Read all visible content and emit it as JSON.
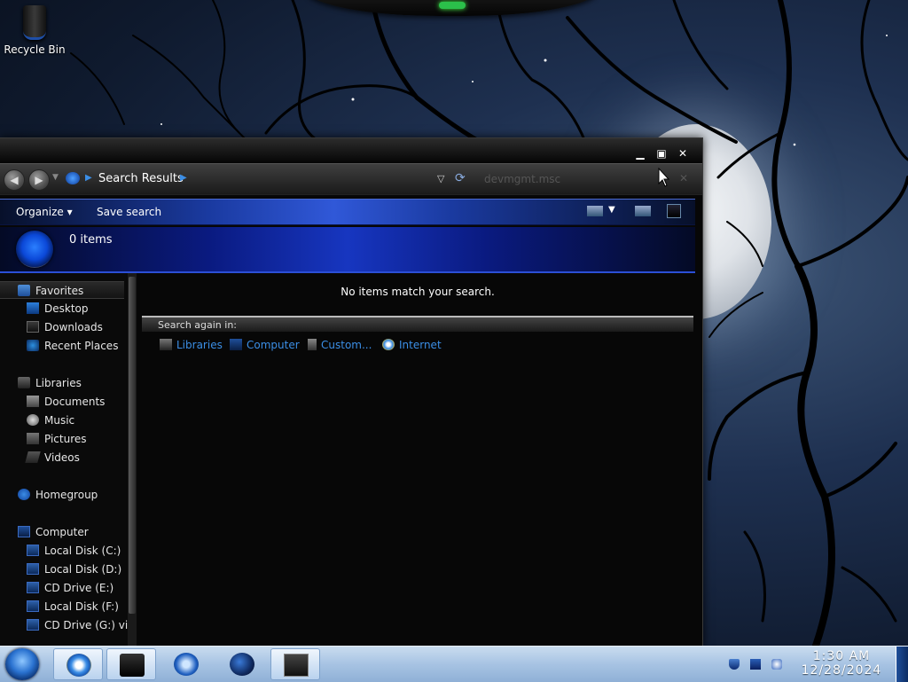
{
  "desktop": {
    "icons": [
      {
        "label": "Recycle Bin",
        "icon": "recycle-bin-icon"
      }
    ]
  },
  "explorer": {
    "address": {
      "breadcrumb": "Search Results",
      "search_text": "devmgmt.msc"
    },
    "toolbar": {
      "organize_label": "Organize",
      "save_search_label": "Save search"
    },
    "details": {
      "item_count": "0 items"
    },
    "nav_pane": {
      "favorites": {
        "label": "Favorites",
        "items": [
          "Desktop",
          "Downloads",
          "Recent Places"
        ]
      },
      "libraries": {
        "label": "Libraries",
        "items": [
          "Documents",
          "Music",
          "Pictures",
          "Videos"
        ]
      },
      "homegroup": {
        "label": "Homegroup"
      },
      "computer": {
        "label": "Computer",
        "items": [
          "Local Disk (C:)",
          "Local Disk (D:)",
          "CD Drive (E:)",
          "Local Disk (F:)",
          "CD Drive (G:) virt"
        ]
      }
    },
    "content": {
      "empty_message": "No items match your search.",
      "search_again_label": "Search again in:",
      "search_again_options": [
        "Libraries",
        "Computer",
        "Custom...",
        "Internet"
      ]
    }
  },
  "taskbar": {
    "pinned": [
      {
        "name": "internet-explorer-icon"
      },
      {
        "name": "explorer-window-icon"
      },
      {
        "name": "media-player-icon"
      },
      {
        "name": "globe-icon"
      },
      {
        "name": "computer-window-icon"
      }
    ],
    "clock": {
      "time": "1:30 AM",
      "date": "12/28/2024"
    }
  }
}
